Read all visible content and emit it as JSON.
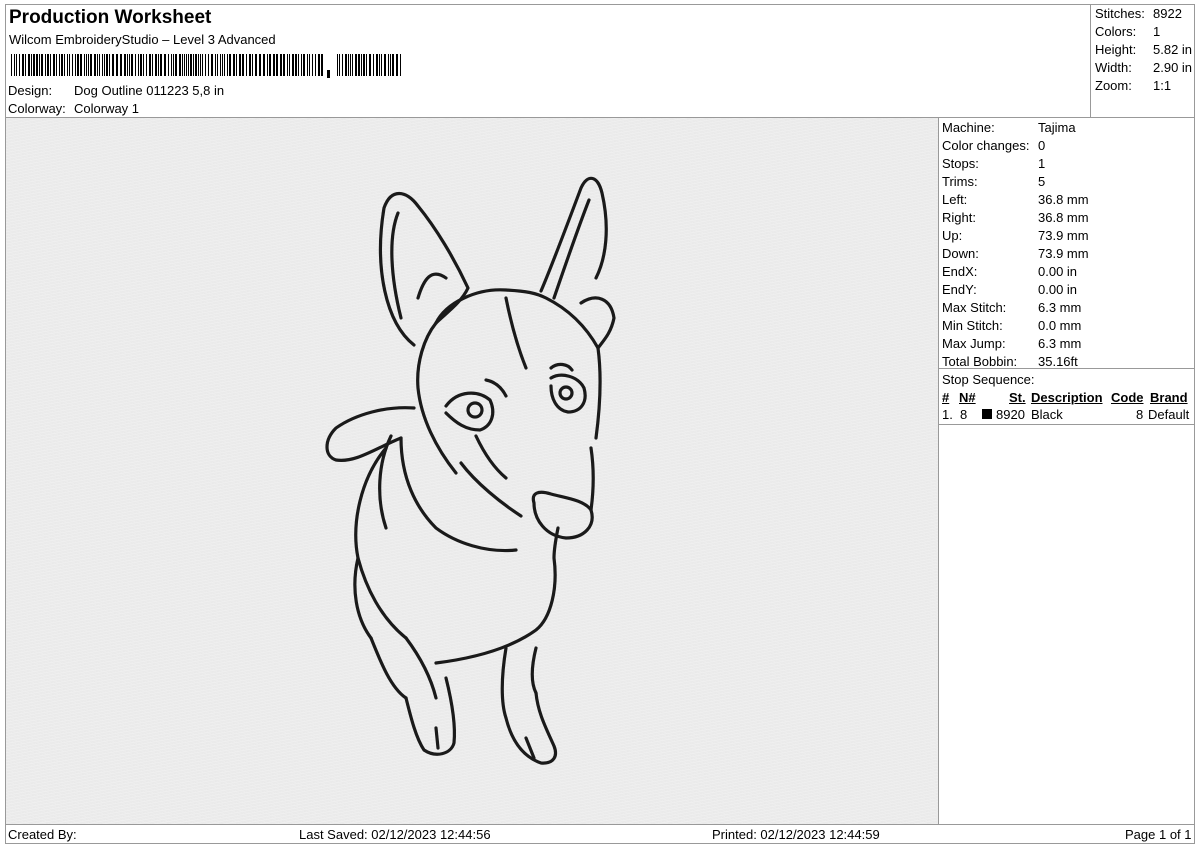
{
  "header": {
    "title": "Production Worksheet",
    "subtitle": "Wilcom EmbroideryStudio – Level 3 Advanced",
    "design_label": "Design:",
    "design_value": "Dog Outline 011223  5,8 in",
    "colorway_label": "Colorway:",
    "colorway_value": "Colorway 1"
  },
  "summary": [
    {
      "label": "Stitches:",
      "value": "8922"
    },
    {
      "label": "Colors:",
      "value": "1"
    },
    {
      "label": "Height:",
      "value": "5.82 in"
    },
    {
      "label": "Width:",
      "value": "2.90 in"
    },
    {
      "label": "Zoom:",
      "value": "1:1"
    }
  ],
  "properties": [
    {
      "label": "Machine:",
      "value": "Tajima"
    },
    {
      "label": "Color changes:",
      "value": "0"
    },
    {
      "label": "Stops:",
      "value": "1"
    },
    {
      "label": "Trims:",
      "value": "5"
    },
    {
      "label": "Left:",
      "value": "36.8 mm"
    },
    {
      "label": "Right:",
      "value": "36.8 mm"
    },
    {
      "label": "Up:",
      "value": "73.9 mm"
    },
    {
      "label": "Down:",
      "value": "73.9 mm"
    },
    {
      "label": "EndX:",
      "value": "0.00 in"
    },
    {
      "label": "EndY:",
      "value": "0.00 in"
    },
    {
      "label": "Max Stitch:",
      "value": "6.3 mm"
    },
    {
      "label": "Min Stitch:",
      "value": "0.0 mm"
    },
    {
      "label": "Max Jump:",
      "value": "6.3 mm"
    },
    {
      "label": "Total Bobbin:",
      "value": "35.16ft"
    }
  ],
  "stop_sequence": {
    "title": "Stop Sequence:",
    "headers": {
      "num": "#",
      "needle": "N#",
      "stitches": "St.",
      "description": "Description",
      "code": "Code",
      "brand": "Brand"
    },
    "rows": [
      {
        "num": "1.",
        "needle": "8",
        "color": "#000000",
        "stitches": "8920",
        "description": "Black",
        "code": "8",
        "brand": "Default"
      }
    ]
  },
  "footer": {
    "created_by": "Created By:",
    "last_saved": "Last Saved: 02/12/2023 12:44:56",
    "printed": "Printed: 02/12/2023 12:44:59",
    "page": "Page 1 of 1"
  },
  "colors": {
    "thread": "#1a1a1a"
  },
  "icons": [
    "barcode",
    "color-swatch",
    "dog-outline-embroidery"
  ]
}
